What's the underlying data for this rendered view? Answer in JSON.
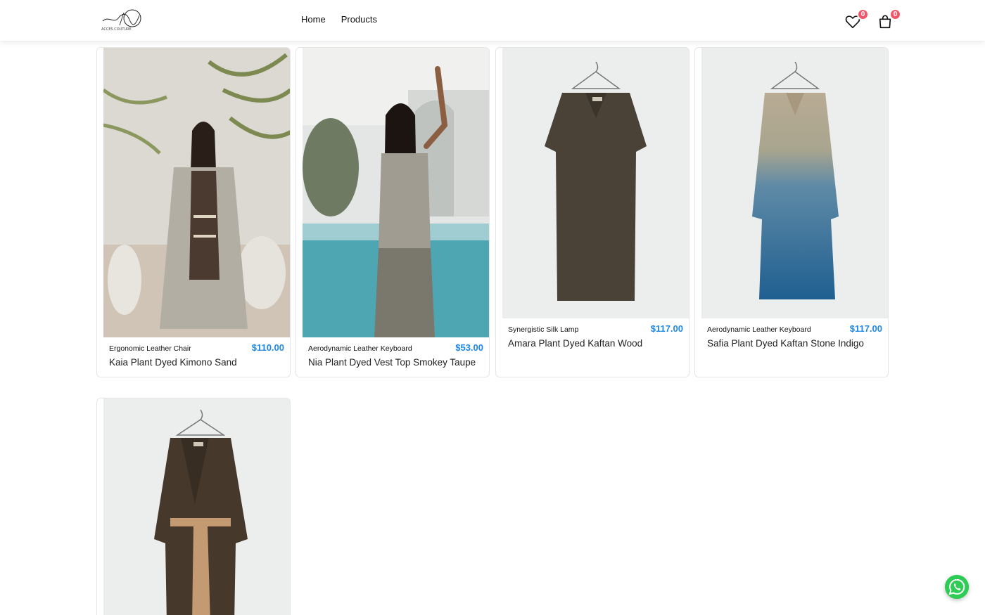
{
  "header": {
    "logo_text": "ACCES COUTURE",
    "nav": [
      {
        "label": "Home"
      },
      {
        "label": "Products"
      }
    ],
    "wishlist_count": "0",
    "cart_count": "0"
  },
  "products": [
    {
      "category": "Ergonomic Leather Chair",
      "price": "$110.00",
      "name": "Kaia Plant Dyed Kimono Sand",
      "image": "photo-model-kimono-sand"
    },
    {
      "category": "Aerodynamic Leather Keyboard",
      "price": "$53.00",
      "name": "Nia Plant Dyed Vest Top Smokey Taupe",
      "image": "photo-model-vest-pool"
    },
    {
      "category": "Synergistic Silk Lamp",
      "price": "$117.00",
      "name": "Amara Plant Dyed Kaftan Wood",
      "image": "photo-kaftan-brown-hanger"
    },
    {
      "category": "Aerodynamic Leather Keyboard",
      "price": "$117.00",
      "name": "Safia Plant Dyed Kaftan Stone Indigo",
      "image": "photo-kaftan-indigo-hanger"
    },
    {
      "category": "",
      "price": "",
      "name": "",
      "image": "photo-robe-brown-hanger"
    }
  ],
  "colors": {
    "price": "#1e88e5",
    "badge": "#f2566a",
    "whatsapp": "#2ecc55"
  }
}
